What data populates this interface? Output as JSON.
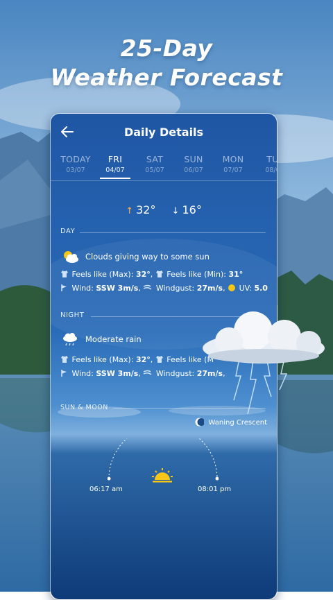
{
  "promo": {
    "line1": "25-Day",
    "line2": "Weather Forecast"
  },
  "app": {
    "title": "Daily Details",
    "back_icon": "back-arrow-icon"
  },
  "tabs": [
    {
      "day": "TODAY",
      "date": "03/07",
      "active": false
    },
    {
      "day": "FRI",
      "date": "04/07",
      "active": true
    },
    {
      "day": "SAT",
      "date": "05/07",
      "active": false
    },
    {
      "day": "SUN",
      "date": "06/07",
      "active": false
    },
    {
      "day": "MON",
      "date": "07/07",
      "active": false
    },
    {
      "day": "TU",
      "date": "08/0",
      "active": false
    }
  ],
  "temps": {
    "high": "32°",
    "low": "16°"
  },
  "day": {
    "label": "DAY",
    "condition": "Clouds giving way to some sun",
    "feels_max_label": "Feels like (Max):",
    "feels_max": "32°",
    "feels_min_label": "Feels like (Min):",
    "feels_min": "31°",
    "wind_label": "Wind:",
    "wind": "SSW 3m/s",
    "gust_label": "Windgust:",
    "gust": "27m/s",
    "uv_label": "UV:",
    "uv": "5.0"
  },
  "night": {
    "label": "NIGHT",
    "condition": "Moderate rain",
    "feels_max_label": "Feels like (Max):",
    "feels_max": "32°",
    "feels_min_label": "Feels like (M",
    "wind_label": "Wind:",
    "wind": "SSW 3m/s",
    "gust_label": "Windgust:",
    "gust": "27m/s"
  },
  "sun_moon": {
    "label": "SUN & MOON",
    "moon_phase": "Waning Crescent",
    "sunrise": "06:17 am",
    "sunset": "08:01 pm"
  },
  "colors": {
    "accent_high": "#f7b046",
    "sun": "#f5c518",
    "card_top": "#1d4f9c",
    "card_bottom": "#0f3a78"
  }
}
